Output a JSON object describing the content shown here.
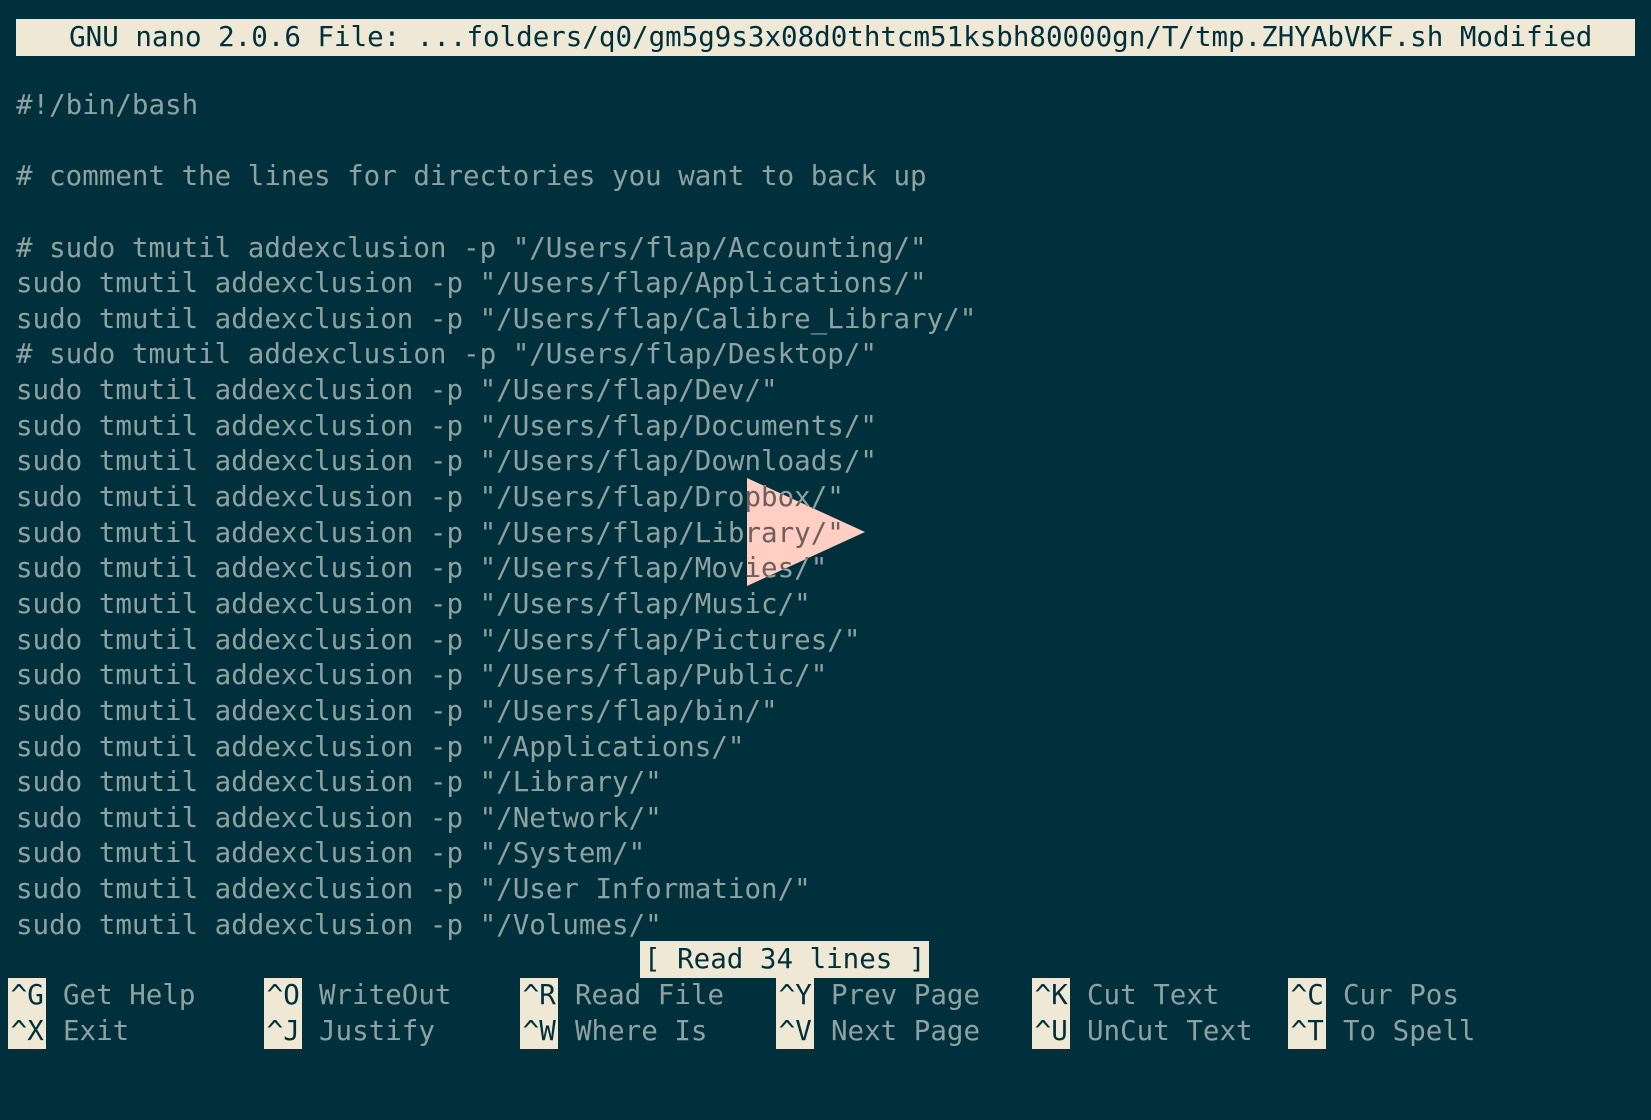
{
  "window": {
    "app": "GNU nano",
    "title_bar": "  GNU nano 2.0.6 File: ...folders/q0/gm5g9s3x08d0thtcm51ksbh80000gn/T/tmp.ZHYAbVKF.sh Modified",
    "version": "2.0.6",
    "file_path": "...folders/q0/gm5g9s3x08d0thtcm51ksbh80000gn/T/tmp.ZHYAbVKF.sh",
    "modified_flag": "Modified"
  },
  "colors": {
    "background": "#00303c",
    "foreground": "#8fa1a1",
    "highlight_bg": "#eee8d5",
    "highlight_fg": "#00303c",
    "overlay": "#ffffff"
  },
  "editor": {
    "lines": [
      "#!/bin/bash",
      "",
      "# comment the lines for directories you want to back up",
      "",
      "# sudo tmutil addexclusion -p \"/Users/flap/Accounting/\"",
      "sudo tmutil addexclusion -p \"/Users/flap/Applications/\"",
      "sudo tmutil addexclusion -p \"/Users/flap/Calibre_Library/\"",
      "# sudo tmutil addexclusion -p \"/Users/flap/Desktop/\"",
      "sudo tmutil addexclusion -p \"/Users/flap/Dev/\"",
      "sudo tmutil addexclusion -p \"/Users/flap/Documents/\"",
      "sudo tmutil addexclusion -p \"/Users/flap/Downloads/\"",
      "sudo tmutil addexclusion -p \"/Users/flap/Dropbox/\"",
      "sudo tmutil addexclusion -p \"/Users/flap/Library/\"",
      "sudo tmutil addexclusion -p \"/Users/flap/Movies/\"",
      "sudo tmutil addexclusion -p \"/Users/flap/Music/\"",
      "sudo tmutil addexclusion -p \"/Users/flap/Pictures/\"",
      "sudo tmutil addexclusion -p \"/Users/flap/Public/\"",
      "sudo tmutil addexclusion -p \"/Users/flap/bin/\"",
      "sudo tmutil addexclusion -p \"/Applications/\"",
      "sudo tmutil addexclusion -p \"/Library/\"",
      "sudo tmutil addexclusion -p \"/Network/\"",
      "sudo tmutil addexclusion -p \"/System/\"",
      "sudo tmutil addexclusion -p \"/User Information/\"",
      "sudo tmutil addexclusion -p \"/Volumes/\""
    ]
  },
  "status_message": "[ Read 34 lines ]",
  "overlay": {
    "icon": "play-triangle-icon"
  },
  "shortcuts": {
    "row1": [
      {
        "key": "^G",
        "label": " Get Help"
      },
      {
        "key": "^O",
        "label": " WriteOut"
      },
      {
        "key": "^R",
        "label": " Read File"
      },
      {
        "key": "^Y",
        "label": " Prev Page"
      },
      {
        "key": "^K",
        "label": " Cut Text"
      },
      {
        "key": "^C",
        "label": " Cur Pos"
      }
    ],
    "row2": [
      {
        "key": "^X",
        "label": " Exit"
      },
      {
        "key": "^J",
        "label": " Justify"
      },
      {
        "key": "^W",
        "label": " Where Is"
      },
      {
        "key": "^V",
        "label": " Next Page"
      },
      {
        "key": "^U",
        "label": " UnCut Text"
      },
      {
        "key": "^T",
        "label": " To Spell"
      }
    ]
  }
}
